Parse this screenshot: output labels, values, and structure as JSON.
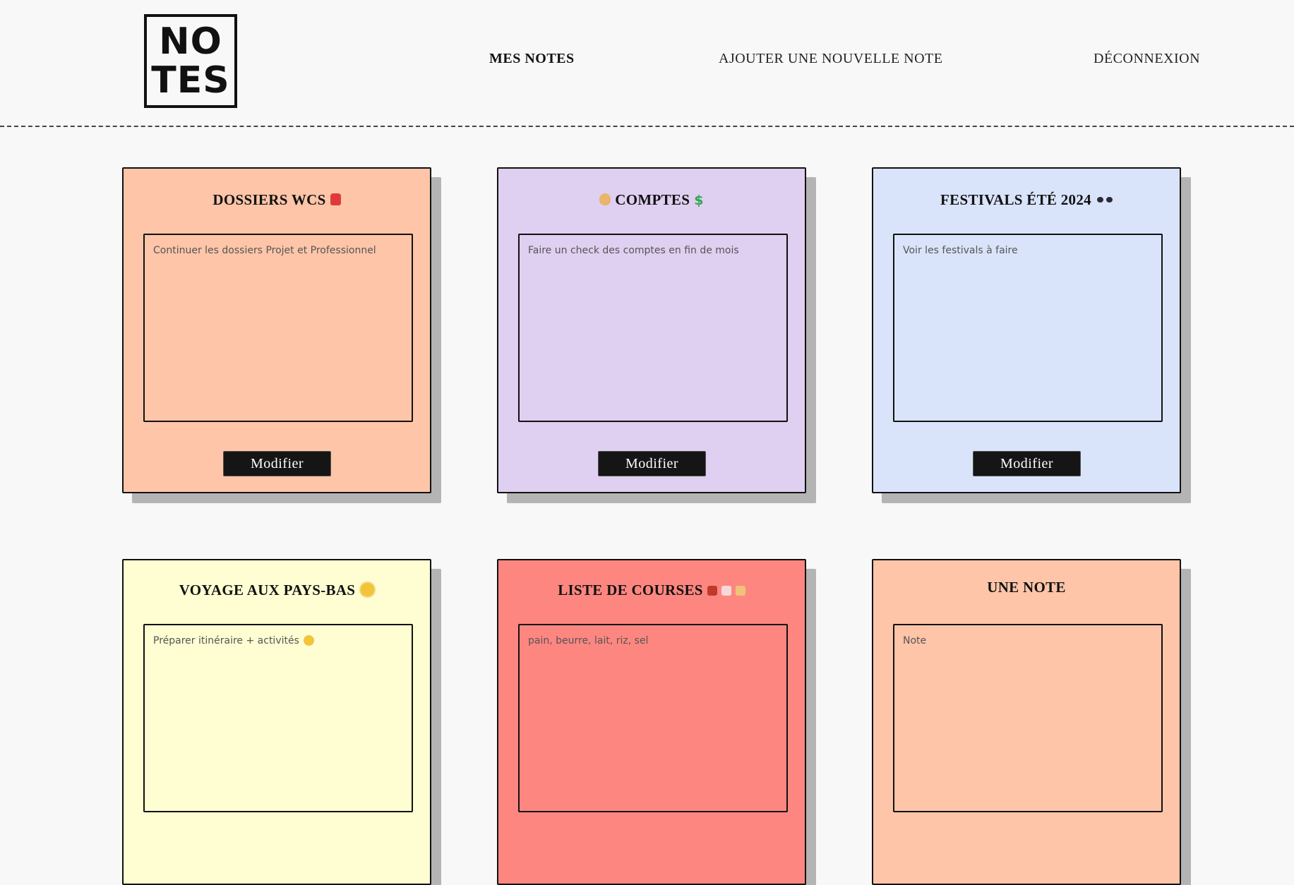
{
  "header": {
    "logo_line1": "NO",
    "logo_line2": "TES",
    "nav": {
      "mes_notes": "MES NOTES",
      "ajouter": "AJOUTER UNE NOUVELLE NOTE",
      "deconnexion": "DÉCONNEXION"
    }
  },
  "notes": [
    {
      "title": "DOSSIERS WCS",
      "body": "Continuer les dossiers Projet et Professionnel",
      "button": "Modifier",
      "color": "#fec5a8",
      "icon": "backpack-icon"
    },
    {
      "title": "COMPTES",
      "body": "Faire un check des comptes en fin de mois",
      "button": "Modifier",
      "color": "#dfcff0",
      "icon": "money-bag-icon"
    },
    {
      "title": "FESTIVALS ÉTÉ 2024",
      "body": "Voir les festivals à faire",
      "button": "Modifier",
      "color": "#d9e4fb",
      "icon": "sunglasses-icon"
    },
    {
      "title": "VOYAGE AUX PAYS-BAS",
      "body": "Préparer itinéraire + activités",
      "color": "#fefed2",
      "icon": "sun-icon"
    },
    {
      "title": "LISTE DE COURSES",
      "body": "pain, beurre, lait, riz, sel",
      "color": "#fd8780",
      "icon": "food-icons"
    },
    {
      "title": "UNE NOTE",
      "body": "Note",
      "color": "#fec5a8"
    }
  ]
}
